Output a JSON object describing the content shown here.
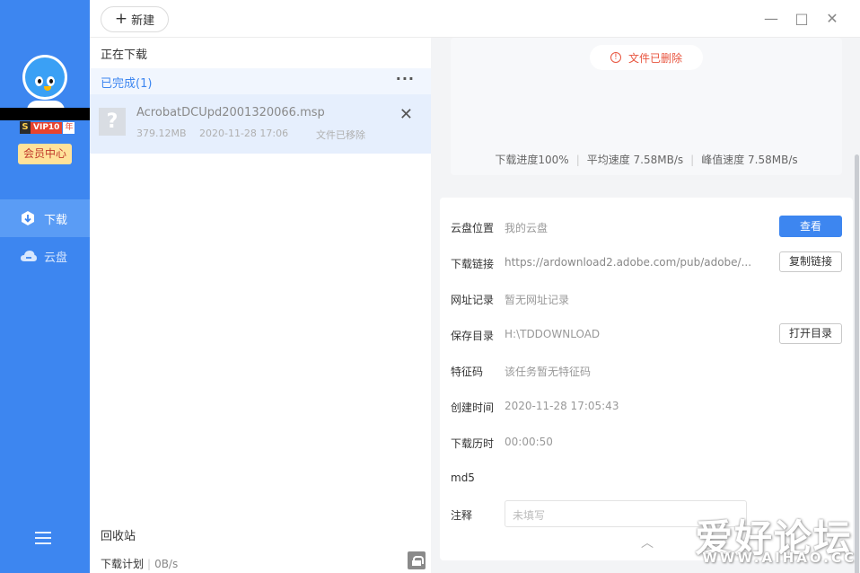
{
  "sidebar": {
    "vip_badge": {
      "s": "S",
      "level": "VIP10",
      "unit": "年"
    },
    "vip_center_label": "会员中心",
    "nav": [
      {
        "label": "下载",
        "icon": "download-icon",
        "active": true
      },
      {
        "label": "云盘",
        "icon": "cloud-icon",
        "active": false
      }
    ],
    "menu_icon": "hamburger-menu-icon"
  },
  "toolbar": {
    "new_label": "新建"
  },
  "window": {
    "minimize": "—",
    "maximize": "□",
    "close": "✕"
  },
  "list": {
    "downloading_label": "正在下载",
    "completed_label": "已完成(1)",
    "more_label": "···",
    "tasks": [
      {
        "name": "AcrobatDCUpd2001320066.msp",
        "size": "379.12MB",
        "time": "2020-11-28 17:06",
        "status": "文件已移除",
        "icon": "unknown-file-icon"
      }
    ],
    "recycle_label": "回收站",
    "plan_label": "下载计划",
    "plan_speed": "0B/s"
  },
  "detail": {
    "deleted_notice": "文件已删除",
    "progress": "下载进度100%",
    "avg_speed": "平均速度 7.58MB/s",
    "peak_speed": "峰值速度 7.58MB/s",
    "rows": {
      "cloud_location": {
        "label": "云盘位置",
        "value": "我的云盘",
        "button": "查看"
      },
      "download_link": {
        "label": "下载链接",
        "value": "https://ardownload2.adobe.com/pub/adobe/...",
        "button": "复制链接"
      },
      "url_record": {
        "label": "网址记录",
        "value": "暂无网址记录"
      },
      "save_dir": {
        "label": "保存目录",
        "value": "H:\\TDDOWNLOAD",
        "button": "打开目录"
      },
      "signature": {
        "label": "特征码",
        "value": "该任务暂无特征码"
      },
      "created": {
        "label": "创建时间",
        "value": "2020-11-28 17:05:43"
      },
      "duration": {
        "label": "下载历时",
        "value": "00:00:50"
      },
      "md5": {
        "label": "md5",
        "value": ""
      },
      "note": {
        "label": "注释",
        "placeholder": "未填写"
      }
    }
  },
  "watermark": {
    "big": "爱好论坛",
    "small": "WWW.AIHAO.CC"
  }
}
